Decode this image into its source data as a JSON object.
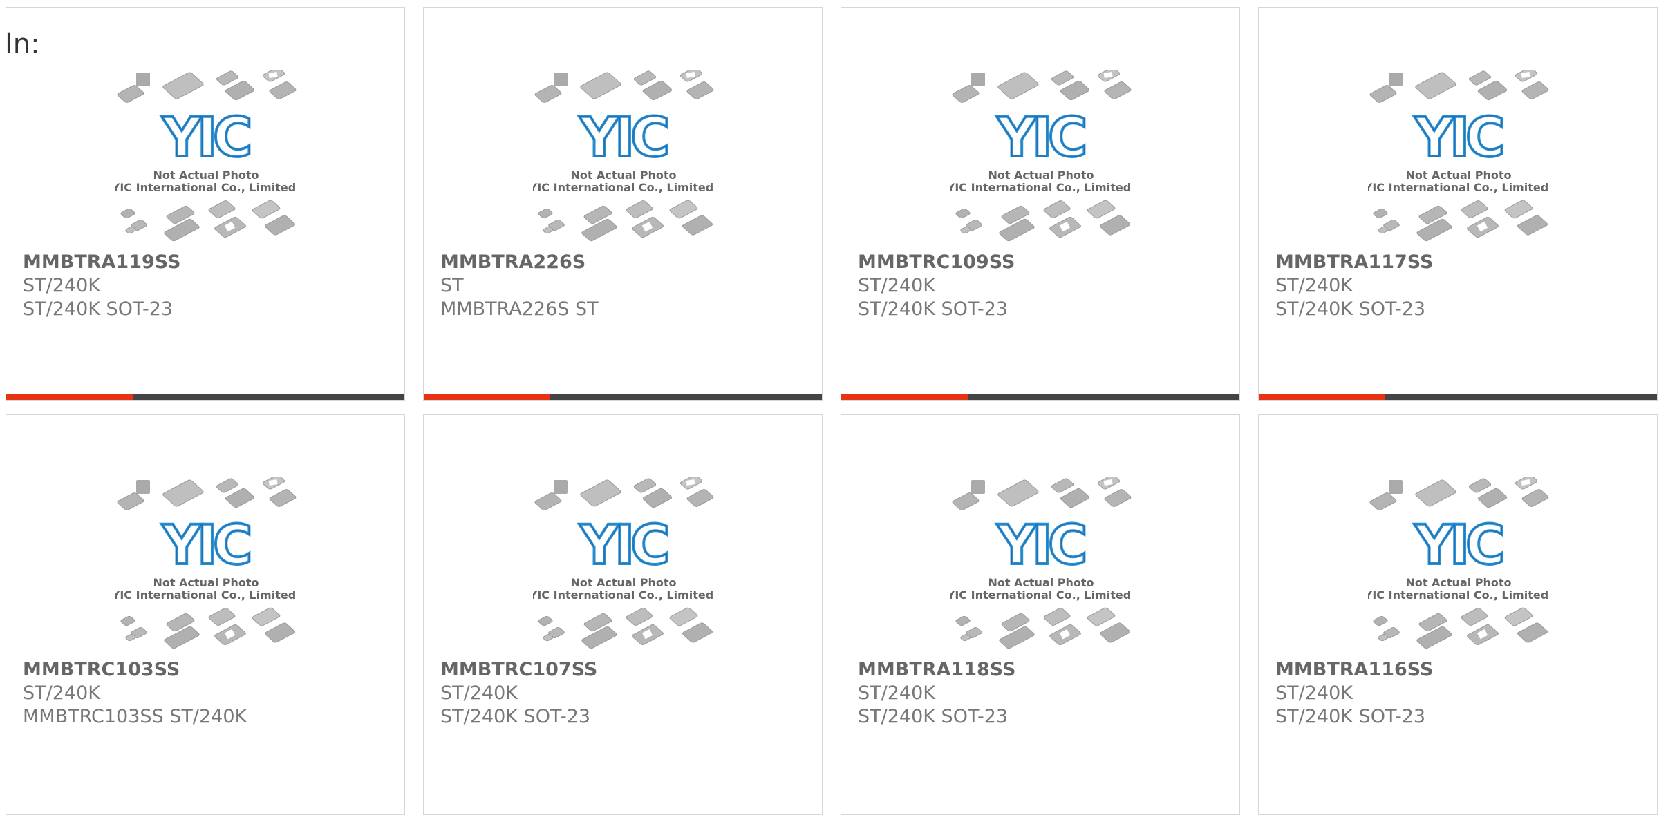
{
  "page": {
    "label": "In:"
  },
  "photo": {
    "brand": "YIC",
    "caption_line1": "Not Actual Photo",
    "caption_line2": "YIC International Co., Limited."
  },
  "colors": {
    "accent": "#e63312",
    "bar": "#444444",
    "logo": "#2a8fd0"
  },
  "products": [
    {
      "part_number": "MMBTRA119SS",
      "line1": "ST/240K",
      "line2": "ST/240K SOT-23"
    },
    {
      "part_number": "MMBTRA226S",
      "line1": "ST",
      "line2": "MMBTRA226S ST"
    },
    {
      "part_number": "MMBTRC109SS",
      "line1": "ST/240K",
      "line2": "ST/240K SOT-23"
    },
    {
      "part_number": "MMBTRA117SS",
      "line1": "ST/240K",
      "line2": "ST/240K SOT-23"
    },
    {
      "part_number": "MMBTRC103SS",
      "line1": "ST/240K",
      "line2": "MMBTRC103SS ST/240K"
    },
    {
      "part_number": "MMBTRC107SS",
      "line1": "ST/240K",
      "line2": "ST/240K SOT-23"
    },
    {
      "part_number": "MMBTRA118SS",
      "line1": "ST/240K",
      "line2": "ST/240K SOT-23"
    },
    {
      "part_number": "MMBTRA116SS",
      "line1": "ST/240K",
      "line2": "ST/240K SOT-23"
    }
  ]
}
